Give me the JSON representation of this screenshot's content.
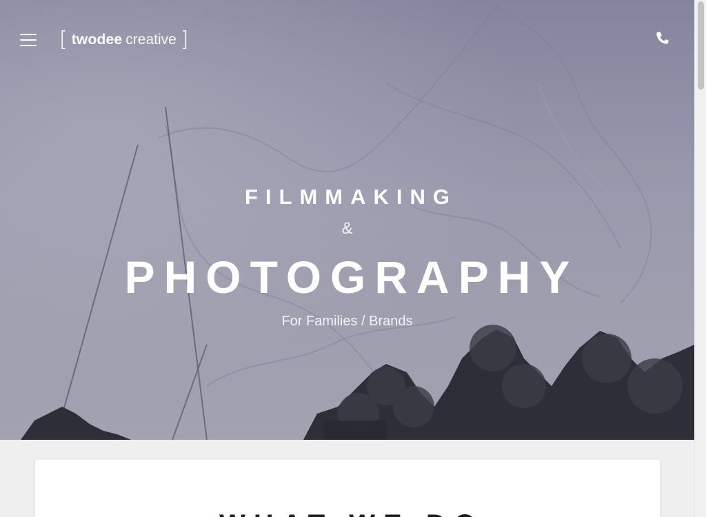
{
  "header": {
    "menu_icon": "hamburger-menu-icon",
    "logo": {
      "bracket_open": "[",
      "bold": "twodee",
      "light": "creative",
      "bracket_close": "]"
    },
    "phone_icon": "phone-icon"
  },
  "hero": {
    "kicker": "FILMMAKING",
    "amp": "&",
    "headline": "PHOTOGRAPHY",
    "subline": "For Families / Brands"
  },
  "section": {
    "title": "WHAT WE DO"
  },
  "colors": {
    "hero_tint": "#a5a6b8",
    "page_background": "#efefef",
    "card_background": "#ffffff",
    "text_light": "#ffffff",
    "text_dark": "#1e1e1e"
  }
}
